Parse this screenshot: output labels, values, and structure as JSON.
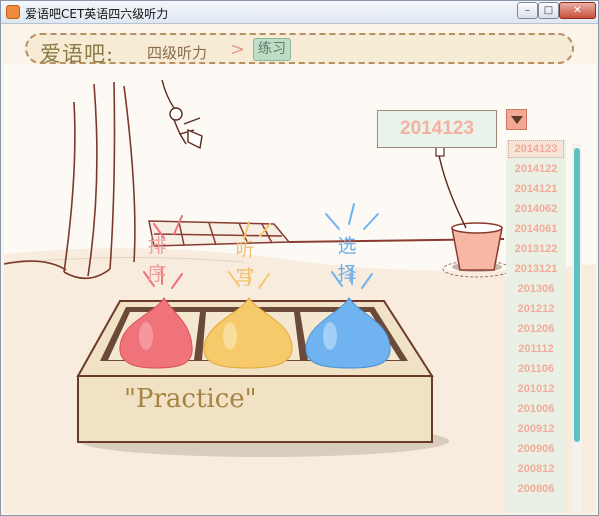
{
  "window": {
    "title": "爱语吧CET英语四六级听力",
    "min_glyph": "–",
    "max_glyph": "□",
    "close_glyph": "✕"
  },
  "nav": {
    "brand": "爱语吧:",
    "section": "四级听力",
    "separator": ">",
    "current": "练习"
  },
  "exam_selector": {
    "selected": "2014123",
    "items": [
      "2014123",
      "2014122",
      "2014121",
      "2014062",
      "2014061",
      "2013122",
      "2013121",
      "201306",
      "201212",
      "201206",
      "201112",
      "201106",
      "201012",
      "201006",
      "200912",
      "200906",
      "200812",
      "200806"
    ]
  },
  "practice": {
    "sign": "\"Practice\"",
    "buttons": [
      {
        "label": "排序",
        "color": "#f0727a"
      },
      {
        "label": "听写",
        "color": "#f6c96a"
      },
      {
        "label": "选择",
        "color": "#6fb4f0"
      }
    ]
  },
  "colors": {
    "accent": "#5cc2bf",
    "list_text": "#f2ab9a",
    "sort_label": "#f09a9a",
    "dictation_label": "#f2c271",
    "choice_label": "#6fb0ea"
  }
}
